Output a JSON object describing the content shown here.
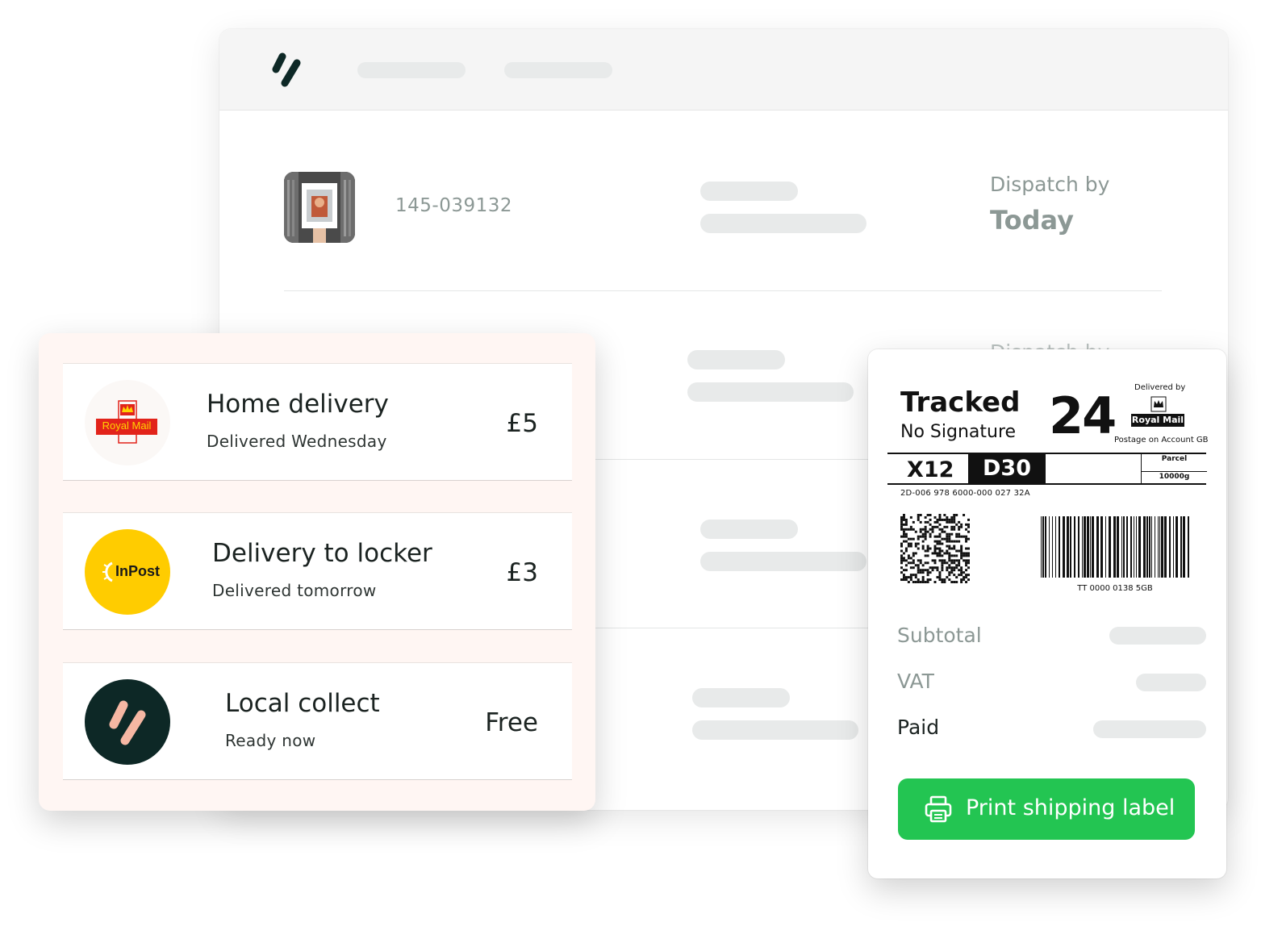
{
  "order": {
    "id": "145-039132",
    "dispatch_label": "Dispatch by",
    "dispatch_value": "Today",
    "dispatch_label_partial": "Dispatch by"
  },
  "delivery_options": [
    {
      "carrier_logo_text": "Royal Mail",
      "title": "Home delivery",
      "subtitle": "Delivered Wednesday",
      "price": "£5",
      "logo_color": "#e2231a"
    },
    {
      "carrier_logo_text": "InPost",
      "title": "Delivery to locker",
      "subtitle": "Delivered tomorrow",
      "price": "£3",
      "logo_color": "#ffcc00"
    },
    {
      "carrier_logo_text": "",
      "title": "Local collect",
      "subtitle": "Ready now",
      "price": "Free",
      "logo_color": "#0d2826"
    }
  ],
  "shipping_label": {
    "service": "Tracked",
    "service_sub": "No Signature",
    "service_number": "24",
    "delivered_by": "Delivered by",
    "carrier_badge": "Royal Mail",
    "postage_note": "Postage on Account GB",
    "sort_code": "X12",
    "route_code": "D30",
    "parcel_label": "Parcel",
    "weight": "10000g",
    "reference": "2D-006 978 6000-000 027 32A",
    "barcode_number": "TT 0000 0138 5GB"
  },
  "summary": {
    "subtotal_label": "Subtotal",
    "vat_label": "VAT",
    "paid_label": "Paid"
  },
  "actions": {
    "print_label": "Print shipping label"
  },
  "colors": {
    "accent_green": "#23c552",
    "brand_dark": "#0d2826",
    "brand_peach": "#f6b7a3",
    "card_bg": "#fff6f3"
  },
  "icons": [
    "brand-logo-icon",
    "royal-mail-logo",
    "inpost-logo",
    "local-collect-logo",
    "printer-icon",
    "crown-icon"
  ]
}
